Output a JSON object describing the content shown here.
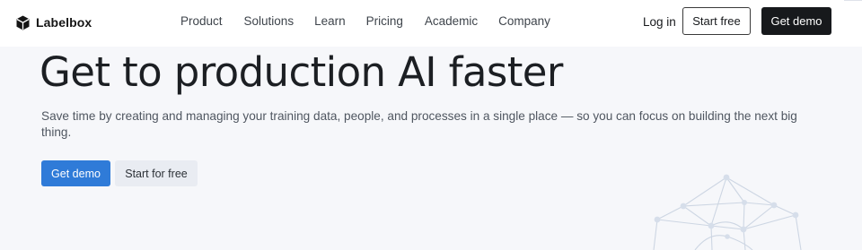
{
  "brand": {
    "name": "Labelbox",
    "logo_icon": "labelbox-cube-icon"
  },
  "nav": {
    "items": [
      {
        "label": "Product"
      },
      {
        "label": "Solutions"
      },
      {
        "label": "Learn"
      },
      {
        "label": "Pricing"
      },
      {
        "label": "Academic"
      },
      {
        "label": "Company"
      }
    ]
  },
  "header_actions": {
    "login_label": "Log in",
    "start_free_label": "Start free",
    "get_demo_label": "Get demo"
  },
  "hero": {
    "title": "Get to production AI faster",
    "subtitle": "Save time by creating and managing your training data, people, and processes in a single place — so you can focus on building the next big thing.",
    "primary_cta": "Get demo",
    "secondary_cta": "Start for free"
  },
  "colors": {
    "page_background": "#f6f7fa",
    "header_background": "#ffffff",
    "primary_button": "#2f7bd8",
    "dark_button": "#17191c",
    "secondary_button": "#e9ecf2",
    "decoration_line": "#cdd6e3"
  }
}
